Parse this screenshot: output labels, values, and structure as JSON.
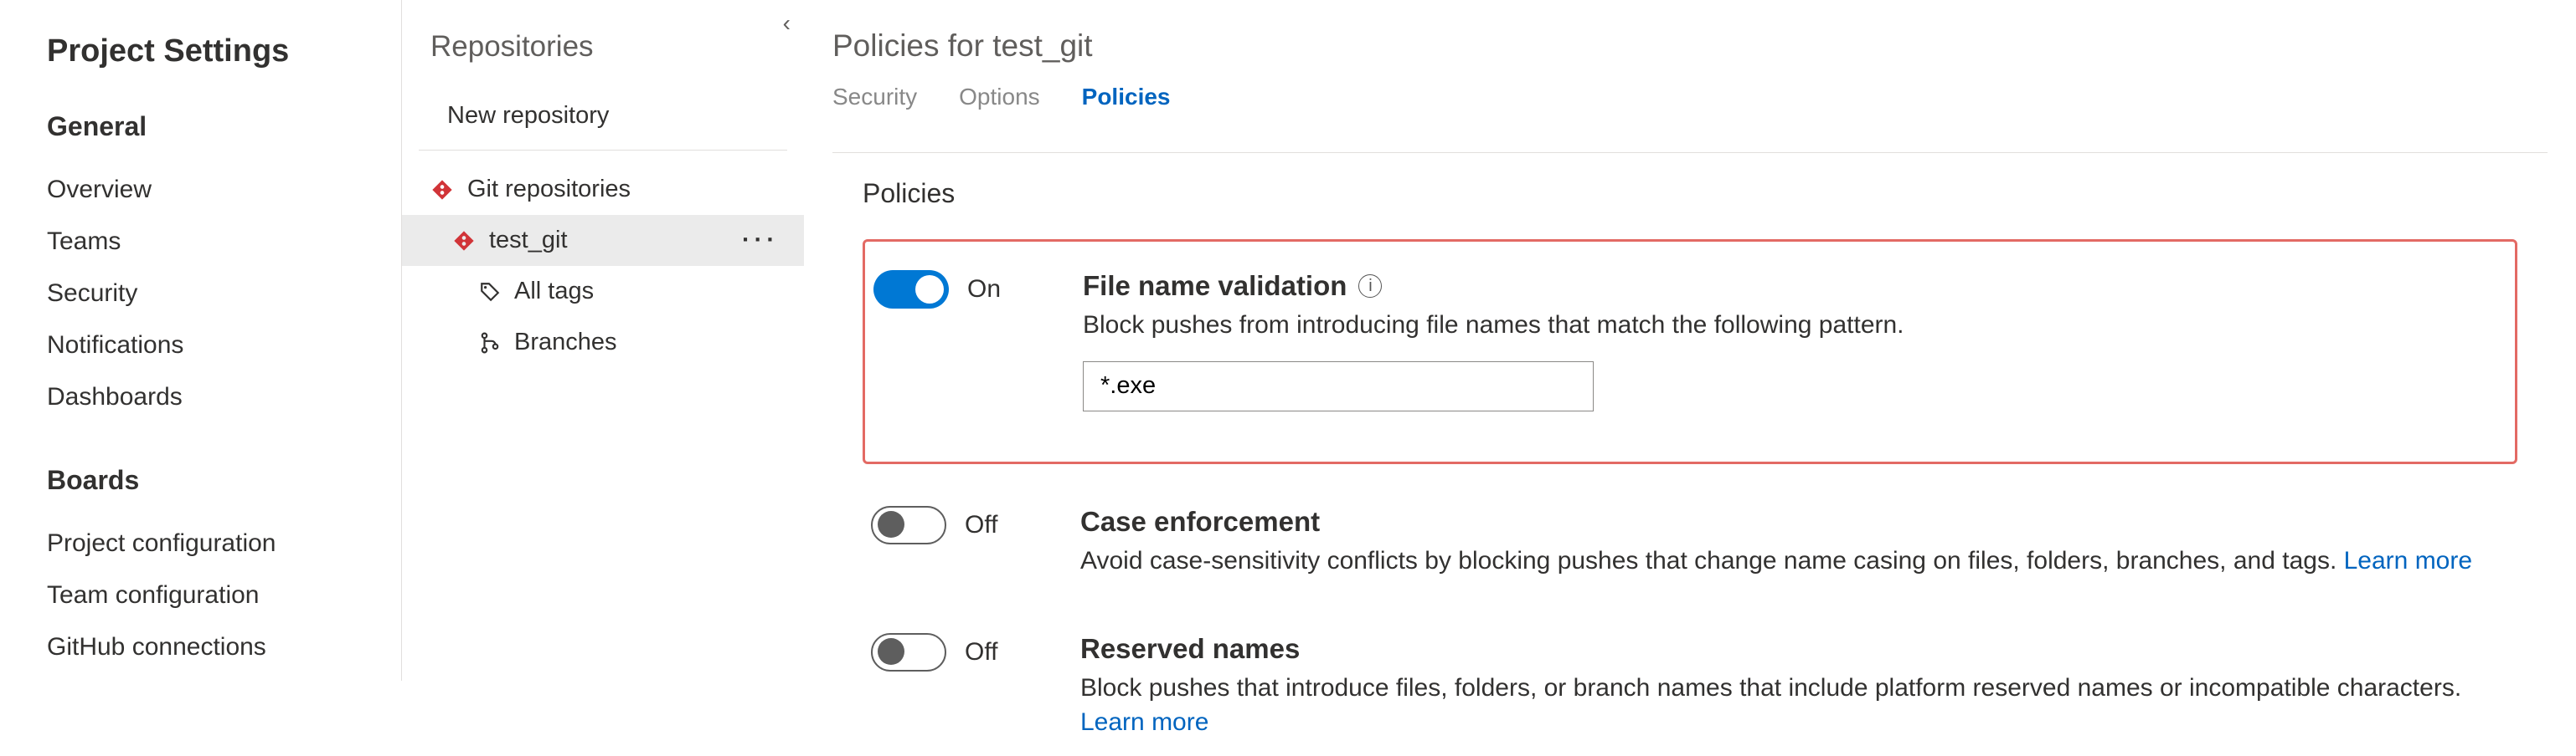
{
  "sidebar": {
    "title": "Project Settings",
    "groups": [
      {
        "label": "General",
        "items": [
          "Overview",
          "Teams",
          "Security",
          "Notifications",
          "Dashboards"
        ]
      },
      {
        "label": "Boards",
        "items": [
          "Project configuration",
          "Team configuration",
          "GitHub connections"
        ]
      }
    ]
  },
  "repos_panel": {
    "title": "Repositories",
    "new_repository_label": "New repository",
    "tree": {
      "root_label": "Git repositories",
      "repo_label": "test_git",
      "all_tags_label": "All tags",
      "branches_label": "Branches"
    }
  },
  "main": {
    "heading": "Policies for test_git",
    "tabs": [
      "Security",
      "Options",
      "Policies"
    ],
    "active_tab_index": 2,
    "section_title": "Policies",
    "toggle_on_label": "On",
    "toggle_off_label": "Off",
    "learn_more_label": "Learn more",
    "policies": {
      "file_name_validation": {
        "title": "File name validation",
        "desc": "Block pushes from introducing file names that match the following pattern.",
        "pattern_value": "*.exe",
        "enabled": true
      },
      "case_enforcement": {
        "title": "Case enforcement",
        "desc": "Avoid case-sensitivity conflicts by blocking pushes that change name casing on files, folders, branches, and tags.",
        "enabled": false
      },
      "reserved_names": {
        "title": "Reserved names",
        "desc": "Block pushes that introduce files, folders, or branch names that include platform reserved names or incompatible characters.",
        "enabled": false
      }
    }
  }
}
